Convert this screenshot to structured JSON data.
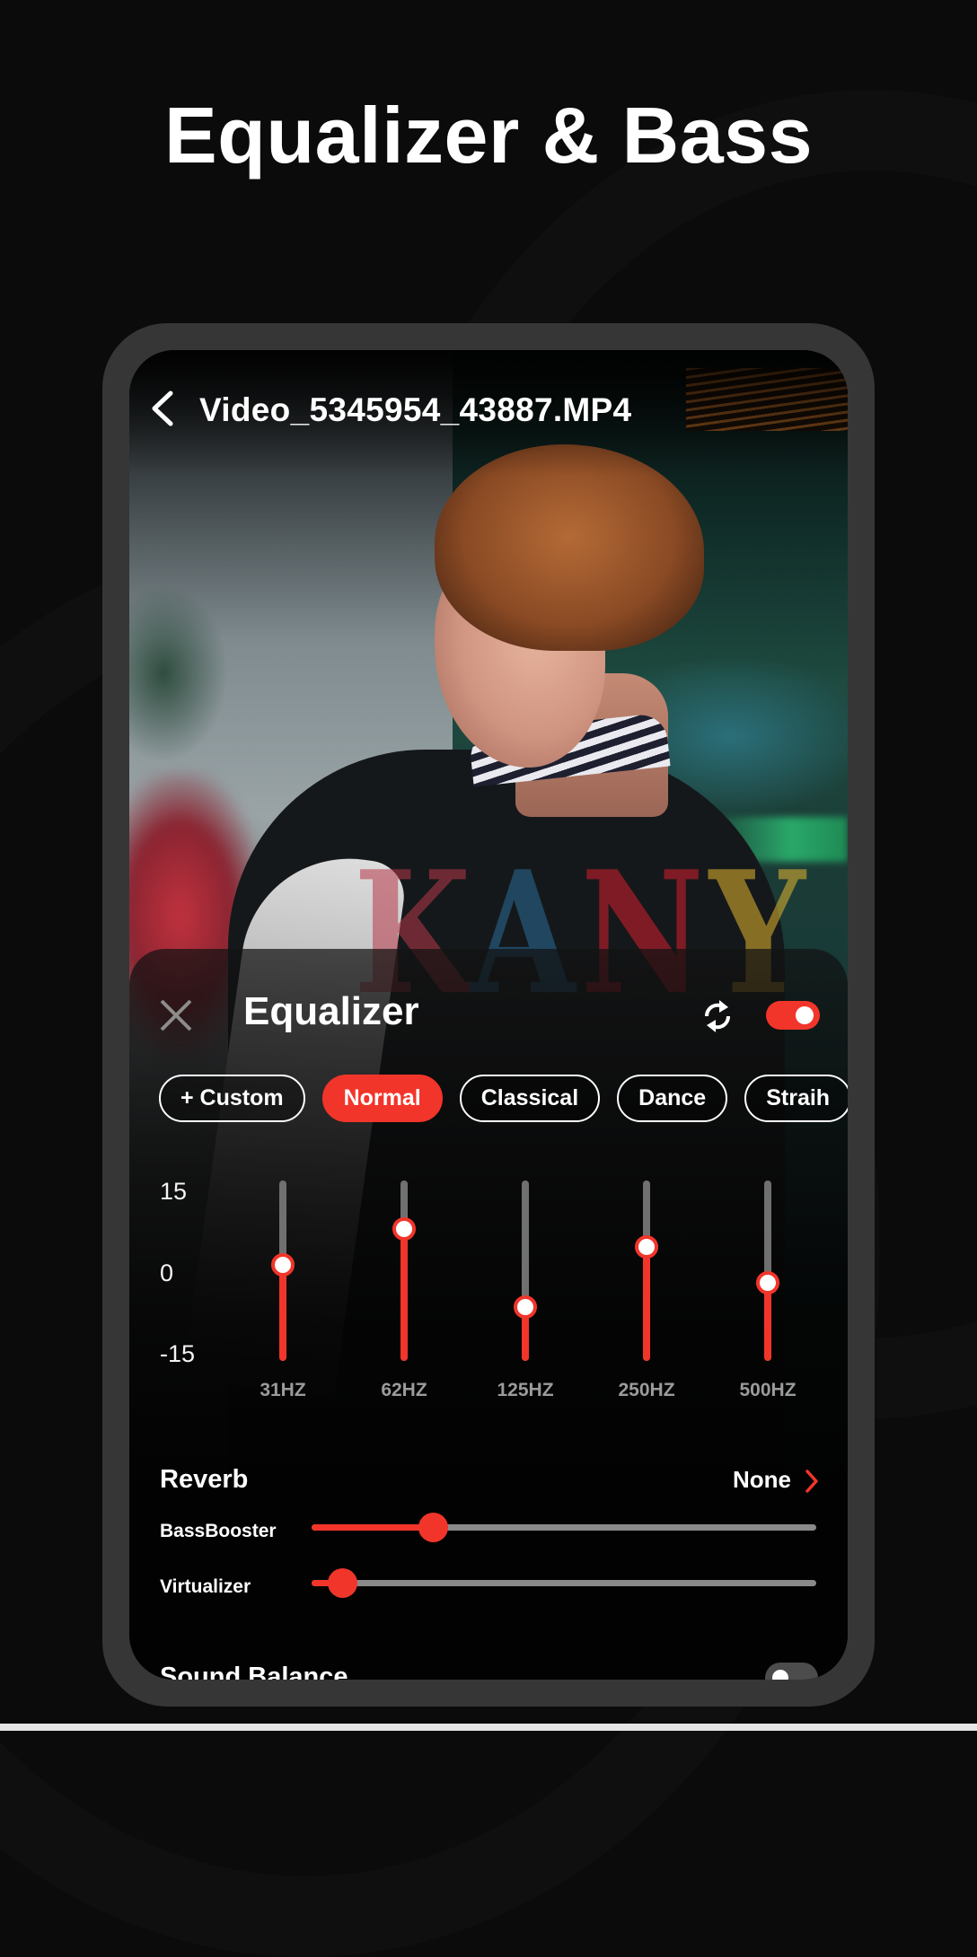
{
  "headline": "Equalizer & Bass",
  "video": {
    "title": "Video_5345954_43887.MP4",
    "jacket_letters": [
      "K",
      "A",
      "N",
      "Y"
    ]
  },
  "equalizer": {
    "title": "Equalizer",
    "enabled": true,
    "presets": [
      {
        "label": "+ Custom",
        "active": false
      },
      {
        "label": "Normal",
        "active": true
      },
      {
        "label": "Classical",
        "active": false
      },
      {
        "label": "Dance",
        "active": false
      },
      {
        "label": "Straih",
        "active": false
      }
    ],
    "axis": {
      "max_label": "15",
      "mid_label": "0",
      "min_label": "-15",
      "min": -15,
      "max": 15
    },
    "bands": [
      {
        "label": "31HZ",
        "value": 1
      },
      {
        "label": "62HZ",
        "value": 7
      },
      {
        "label": "125HZ",
        "value": -6
      },
      {
        "label": "250HZ",
        "value": 4
      },
      {
        "label": "500HZ",
        "value": -2
      }
    ],
    "reverb": {
      "label": "Reverb",
      "value": "None"
    },
    "bass_booster": {
      "label": "BassBooster",
      "value": 0.24
    },
    "virtualizer": {
      "label": "Virtualizer",
      "value": 0.06
    },
    "sound_balance": {
      "label": "Sound Balance",
      "enabled": false
    }
  },
  "colors": {
    "accent": "#f2352a",
    "track": "#707070",
    "frame": "#363636",
    "background": "#0b0b0b"
  }
}
